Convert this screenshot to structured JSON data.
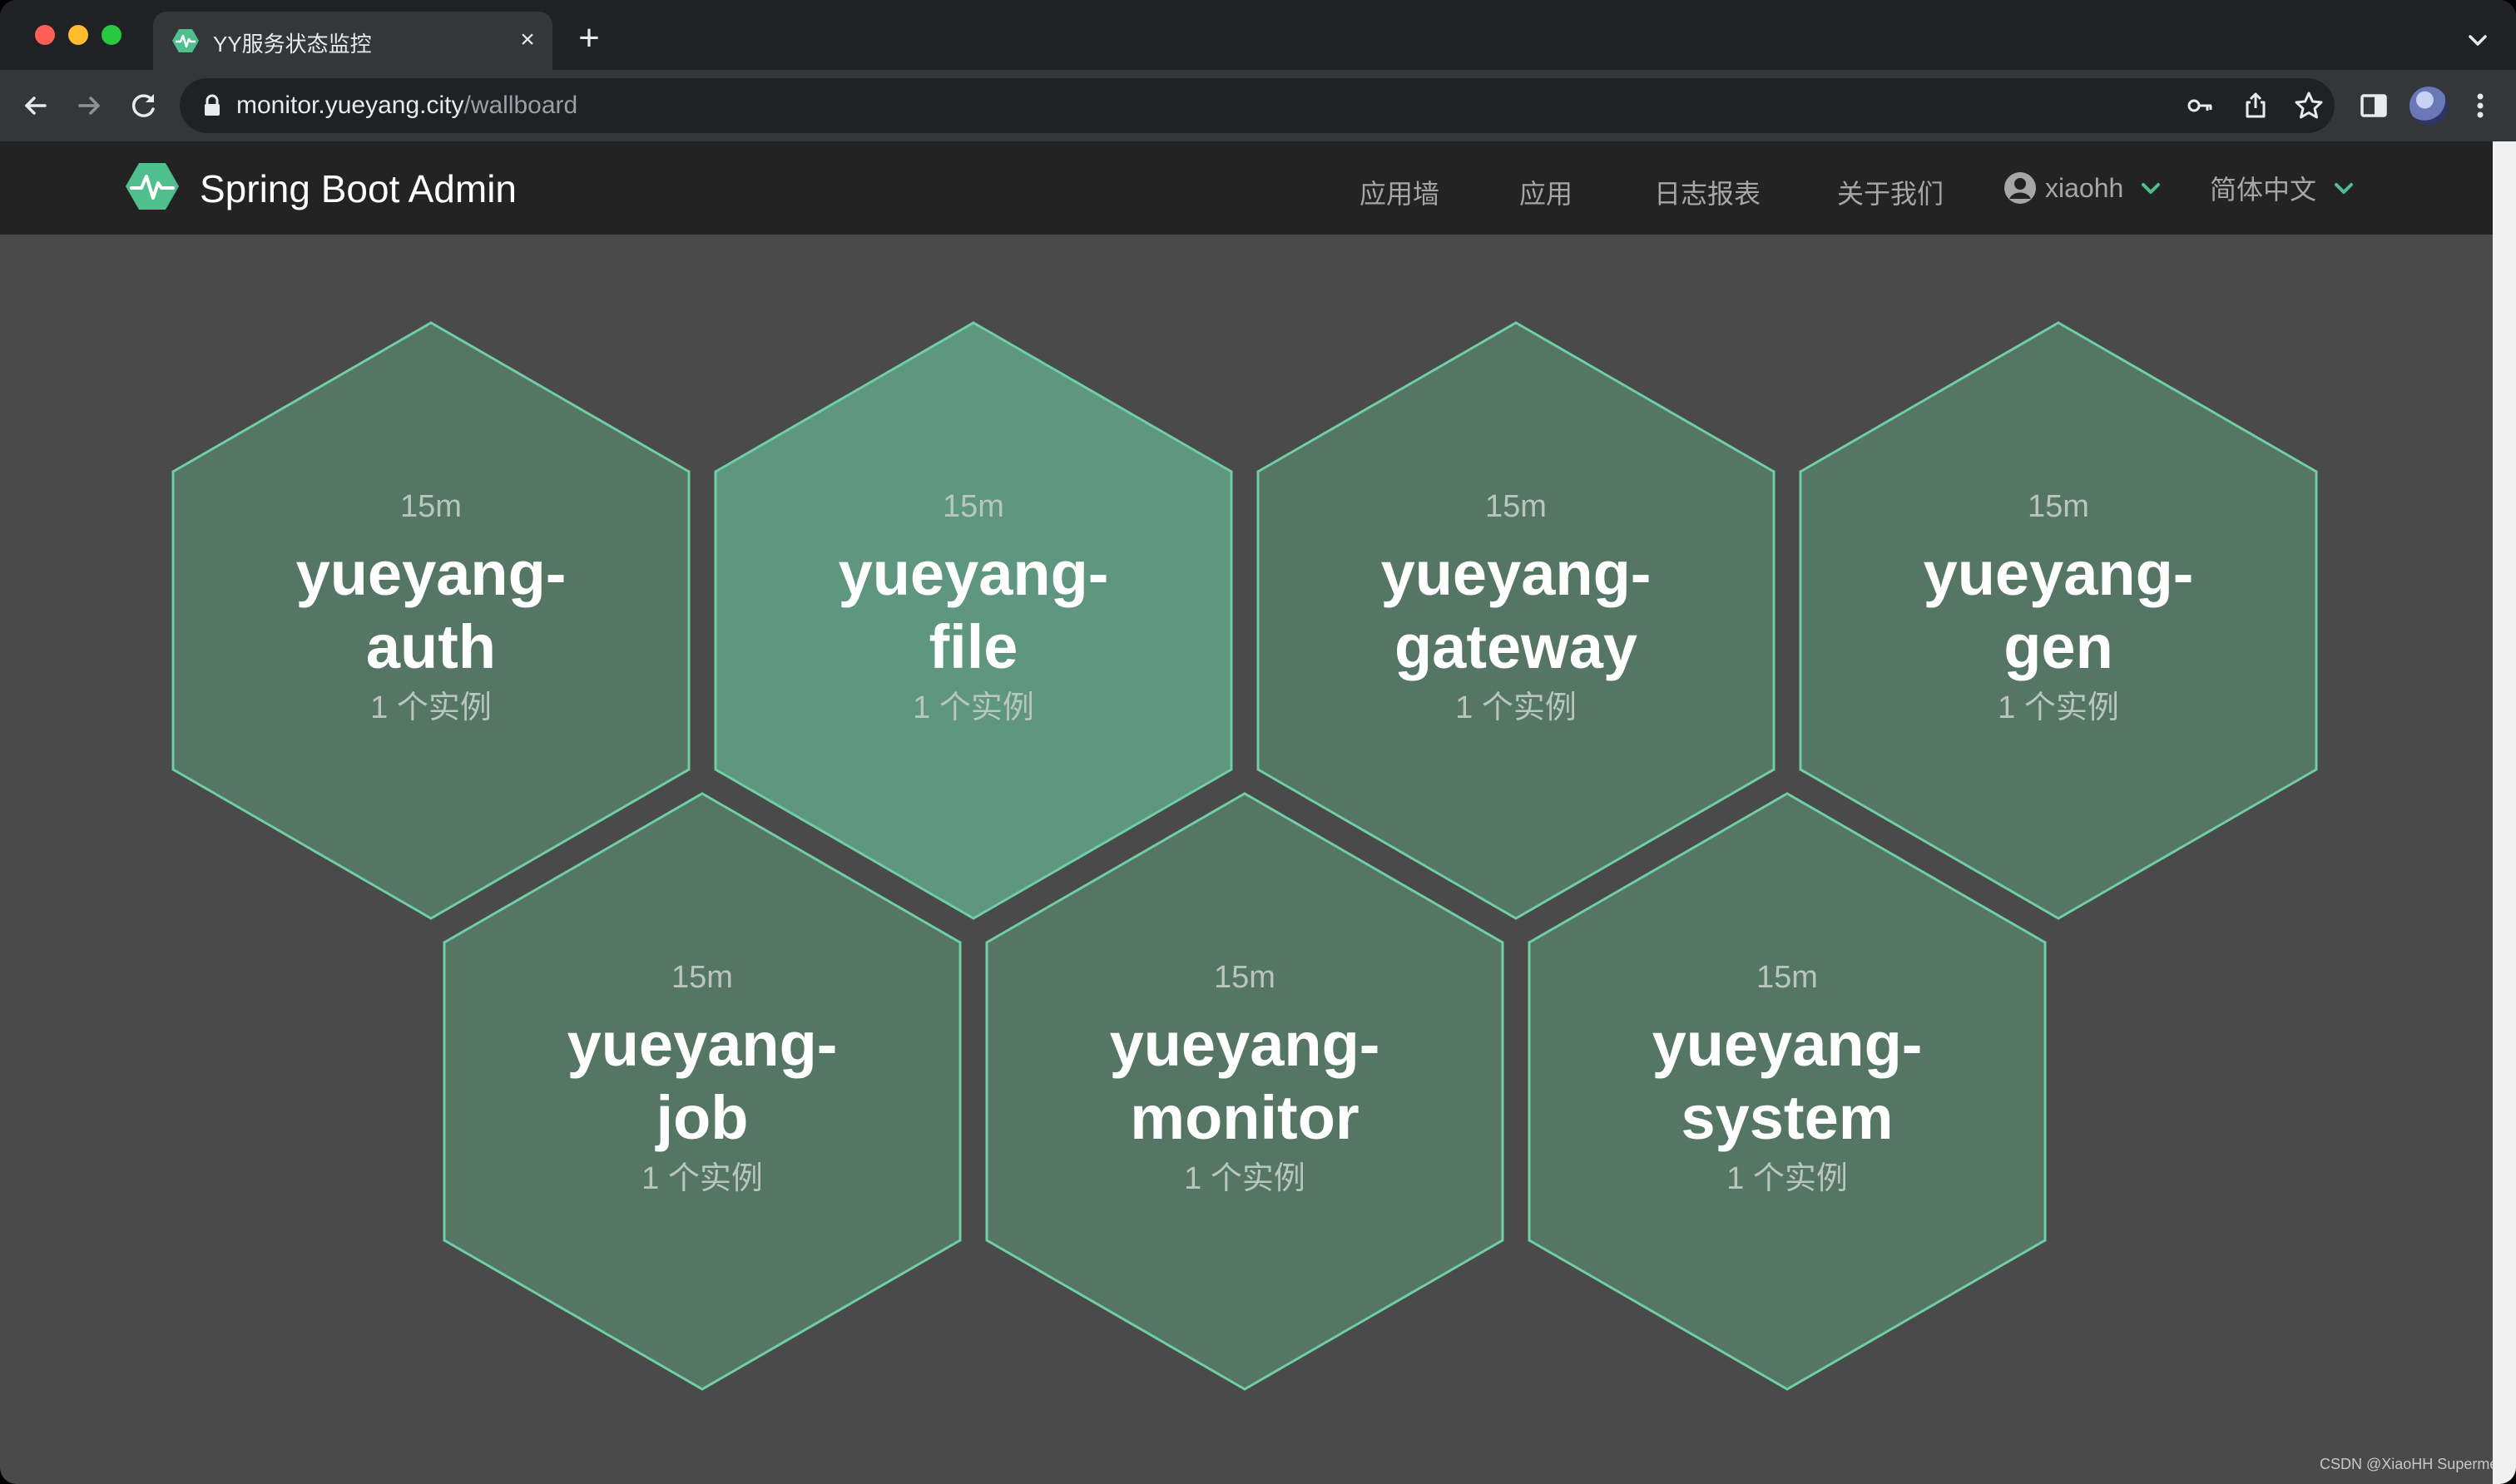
{
  "browser": {
    "tab_title": "YY服务状态监控",
    "tab_close": "×",
    "new_tab": "+",
    "url_host": "monitor.yueyang.city",
    "url_path": "/wallboard"
  },
  "navbar": {
    "brand": "Spring Boot Admin",
    "links": [
      "应用墙",
      "应用",
      "日志报表",
      "关于我们"
    ],
    "user": "xiaohh",
    "language": "简体中文"
  },
  "colors": {
    "hex_fill": "#557565",
    "hex_fill_highlight": "#5e967f",
    "hex_stroke": "#6fcfa4",
    "page_bg": "#4a4a4a",
    "navbar_bg": "#232323",
    "brand_accent": "#4fc08d"
  },
  "applications": [
    {
      "name_line1": "yueyang-",
      "name_line2": "auth",
      "uptime": "15m",
      "instances": "1 个实例",
      "highlight": false
    },
    {
      "name_line1": "yueyang-",
      "name_line2": "file",
      "uptime": "15m",
      "instances": "1 个实例",
      "highlight": true
    },
    {
      "name_line1": "yueyang-",
      "name_line2": "gateway",
      "uptime": "15m",
      "instances": "1 个实例",
      "highlight": false
    },
    {
      "name_line1": "yueyang-",
      "name_line2": "gen",
      "uptime": "15m",
      "instances": "1 个实例",
      "highlight": false
    },
    {
      "name_line1": "yueyang-",
      "name_line2": "job",
      "uptime": "15m",
      "instances": "1 个实例",
      "highlight": false
    },
    {
      "name_line1": "yueyang-",
      "name_line2": "monitor",
      "uptime": "15m",
      "instances": "1 个实例",
      "highlight": false
    },
    {
      "name_line1": "yueyang-",
      "name_line2": "system",
      "uptime": "15m",
      "instances": "1 个实例",
      "highlight": false
    }
  ],
  "watermark": "CSDN @XiaoHH Superme"
}
